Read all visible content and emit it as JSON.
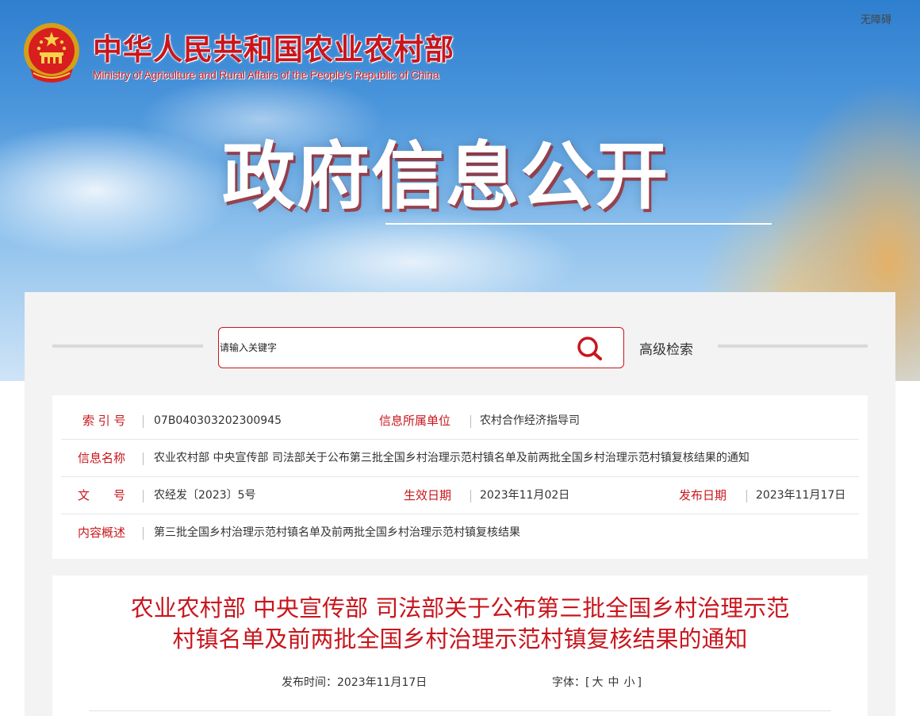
{
  "header": {
    "title_cn": "中华人民共和国农业农村部",
    "title_en": "Ministry of Agriculture and Rural Affairs of the People's Republic of China",
    "accessibility": "无障碍",
    "banner_title": "政府信息公开"
  },
  "search": {
    "placeholder": "请输入关键字",
    "advanced_label": "高级检索"
  },
  "meta": {
    "index_label": "索 引 号",
    "index_value": "07B040303202300945",
    "unit_label": "信息所属单位",
    "unit_value": "农村合作经济指导司",
    "name_label": "信息名称",
    "name_value": "农业农村部 中央宣传部 司法部关于公布第三批全国乡村治理示范村镇名单及前两批全国乡村治理示范村镇复核结果的通知",
    "doc_label": "文　　号",
    "doc_value": "农经发〔2023〕5号",
    "effective_label": "生效日期",
    "effective_value": "2023年11月02日",
    "publish_label": "发布日期",
    "publish_value": "2023年11月17日",
    "summary_label": "内容概述",
    "summary_value": "第三批全国乡村治理示范村镇名单及前两批全国乡村治理示范村镇复核结果"
  },
  "article": {
    "title_line1": "农业农村部 中央宣传部 司法部关于公布第三批全国乡村治理示范",
    "title_line2": "村镇名单及前两批全国乡村治理示范村镇复核结果的通知",
    "publish_time": "发布时间：2023年11月17日",
    "font_label": "字体：[",
    "font_large": "大",
    "font_medium": "中",
    "font_small": "小",
    "font_close": "]"
  },
  "colors": {
    "brand_red": "#c8161d",
    "panel_bg": "#f3f3f3"
  },
  "icons": [
    "national-emblem-icon",
    "search-icon"
  ]
}
